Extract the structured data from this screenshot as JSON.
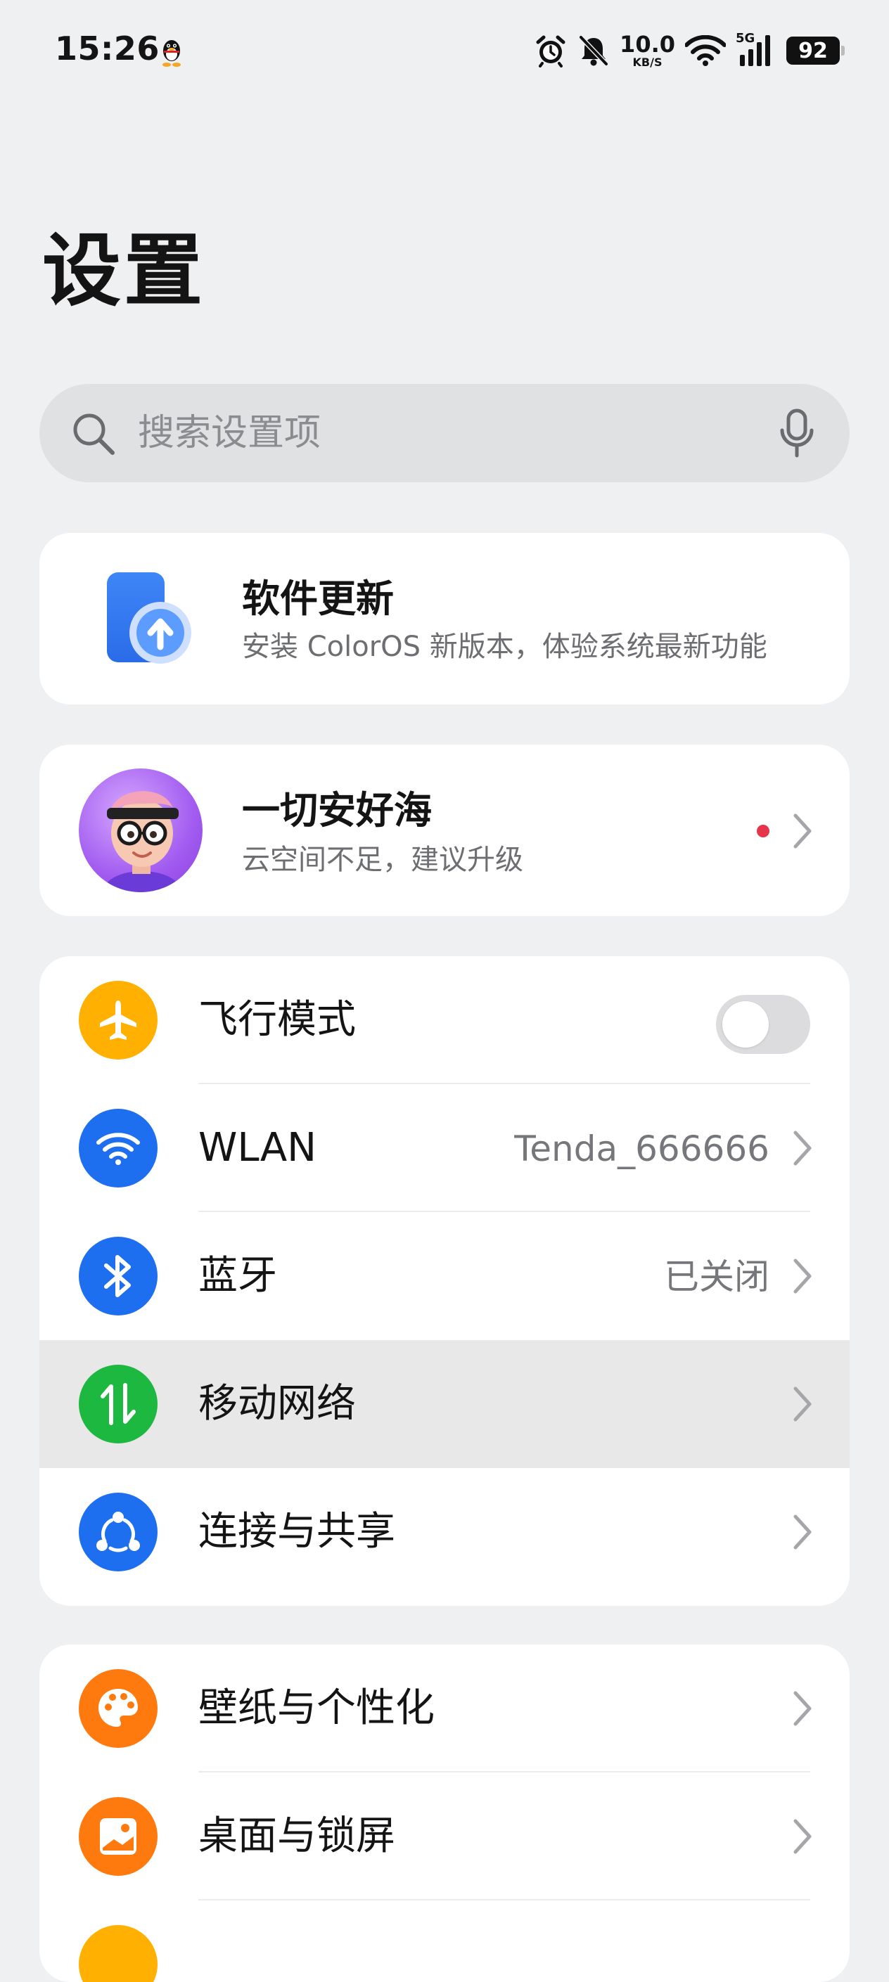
{
  "status_bar": {
    "time": "15:26",
    "net_speed_value": "10.0",
    "net_speed_unit": "KB/S",
    "network_type": "5G",
    "battery": "92",
    "icons": [
      "qq-penguin-icon",
      "alarm-icon",
      "bell-muted-icon",
      "wifi-icon",
      "cellular-signal-icon",
      "battery-icon"
    ]
  },
  "header": {
    "title": "设置"
  },
  "search": {
    "placeholder": "搜索设置项",
    "icons": [
      "search-icon",
      "microphone-icon"
    ]
  },
  "software_update": {
    "title": "软件更新",
    "subtitle": "安装 ColorOS 新版本，体验系统最新功能",
    "icon": "phone-update-icon"
  },
  "account": {
    "name": "一切安好海",
    "subtitle": "云空间不足，建议升级",
    "has_notification_dot": true,
    "icon": "avatar"
  },
  "network_section": [
    {
      "label": "飞行模式",
      "icon": "airplane-icon",
      "icon_color": "#FFB000",
      "type": "toggle",
      "toggle_on": false
    },
    {
      "label": "WLAN",
      "value": "Tenda_666666",
      "icon": "wifi-icon",
      "icon_color": "#1E6FF0",
      "type": "link"
    },
    {
      "label": "蓝牙",
      "value": "已关闭",
      "icon": "bluetooth-icon",
      "icon_color": "#1E6FF0",
      "type": "link"
    },
    {
      "label": "移动网络",
      "icon": "mobile-data-icon",
      "icon_color": "#1DB83F",
      "type": "link",
      "highlighted": true
    },
    {
      "label": "连接与共享",
      "icon": "share-connect-icon",
      "icon_color": "#1E6FF0",
      "type": "link"
    }
  ],
  "personal_section": [
    {
      "label": "壁纸与个性化",
      "icon": "palette-icon",
      "icon_color": "#FF7A0E",
      "type": "link"
    },
    {
      "label": "桌面与锁屏",
      "icon": "picture-icon",
      "icon_color": "#FF7A0E",
      "type": "link"
    }
  ],
  "colors": {
    "background": "#EFF0F2",
    "card": "#FFFFFF",
    "accent_blue": "#1E6FF0",
    "notification_dot": "#E6344A"
  }
}
